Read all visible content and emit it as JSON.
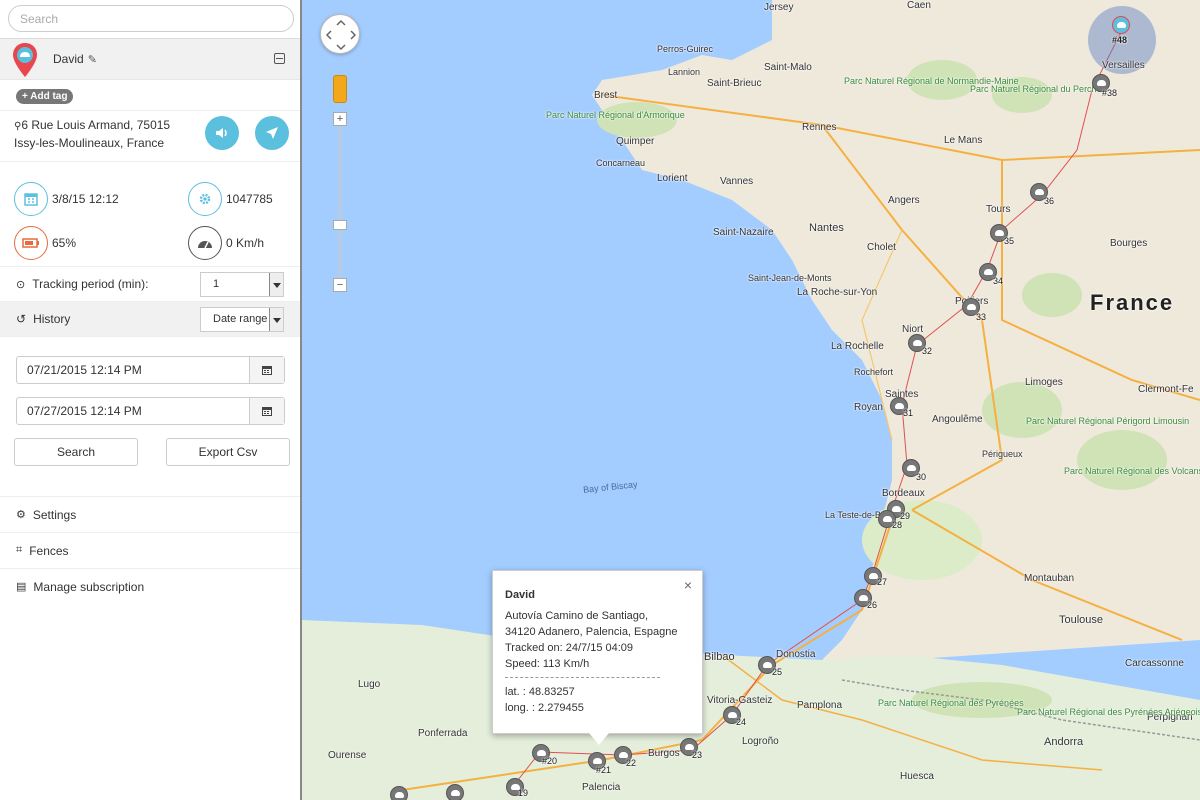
{
  "sidebar": {
    "search_placeholder": "Search",
    "device": {
      "name": "David",
      "add_tag": "+ Add tag",
      "address_line1": "6 Rue Louis Armand, 75015",
      "address_line2": "Issy-les-Moulineaux, France",
      "date": "3/8/15 12:12",
      "id": "1047785",
      "battery": "65%",
      "speed": "0 Km/h"
    },
    "tracking_period": {
      "label": "Tracking period (min):",
      "value": "1"
    },
    "history": {
      "label": "History",
      "value": "Date range"
    },
    "date_from": "07/21/2015 12:14 PM",
    "date_to": "07/27/2015 12:14 PM",
    "search_button": "Search",
    "export_button": "Export Csv",
    "menu": [
      {
        "label": "Settings"
      },
      {
        "label": "Fences"
      },
      {
        "label": "Manage subscription"
      }
    ]
  },
  "map": {
    "country_label": "France",
    "sea_label": "Bay of Biscay",
    "cities": [
      "Jersey",
      "Caen",
      "Perros-Guirec",
      "Saint-Malo",
      "Lannion",
      "Saint-Brieuc",
      "Brest",
      "Rennes",
      "Quimper",
      "Concarneau",
      "Lorient",
      "Vannes",
      "Le Mans",
      "Angers",
      "Tours",
      "Nantes",
      "Saint-Nazaire",
      "Cholet",
      "Saint-Jean-de-Monts",
      "La Roche-sur-Yon",
      "Poitiers",
      "Bourges",
      "Niort",
      "La Rochelle",
      "Rochefort",
      "Saintes",
      "Royan",
      "Limoges",
      "Clermont-Fe",
      "Angoulême",
      "Périgueux",
      "Bordeaux",
      "La Teste-de-B",
      "Montauban",
      "Toulouse",
      "Carcassonne",
      "Perpignan",
      "Andorra",
      "Bilbao",
      "Donostia",
      "Vitoria-Gasteiz",
      "Pamplona",
      "Logroño",
      "Burgos",
      "Palencia",
      "Lugo",
      "Ourense",
      "Ponferrada",
      "Huesca",
      "Versailles"
    ],
    "parks": [
      "Parc Naturel Régional de Normandie-Maine",
      "Parc Naturel Régional du Perche",
      "Parc Naturel Régional d'Armorique",
      "Parc Naturel Régional Périgord Limousin",
      "Parc Naturel Régional des Volcans d'Auvergne",
      "Parc Naturel Régional des Pyrénées Ariégeoises",
      "Parc Naturel Régional des Pyrénées"
    ],
    "markers": [
      "#48",
      "#38",
      "36",
      "35",
      "34",
      "33",
      "32",
      "31",
      "30",
      "29",
      "28",
      "27",
      "26",
      "25",
      "24",
      "23",
      "22",
      "#21",
      "#20",
      "19"
    ],
    "popup": {
      "title": "David",
      "line1": "Autovía Camino de Santiago,",
      "line2": "34120 Adanero, Palencia, Espagne",
      "tracked": "Tracked on: 24/7/15 04:09",
      "speed": "Speed: 113 Km/h",
      "lat": "lat. : 48.83257",
      "long": "long. : 2.279455",
      "close": "×"
    }
  },
  "colors": {
    "accent": "#5bc0de",
    "battery": "#e96a3c",
    "sea": "#a3ccff",
    "land": "#efe9dc",
    "spain": "#e4eedb"
  }
}
